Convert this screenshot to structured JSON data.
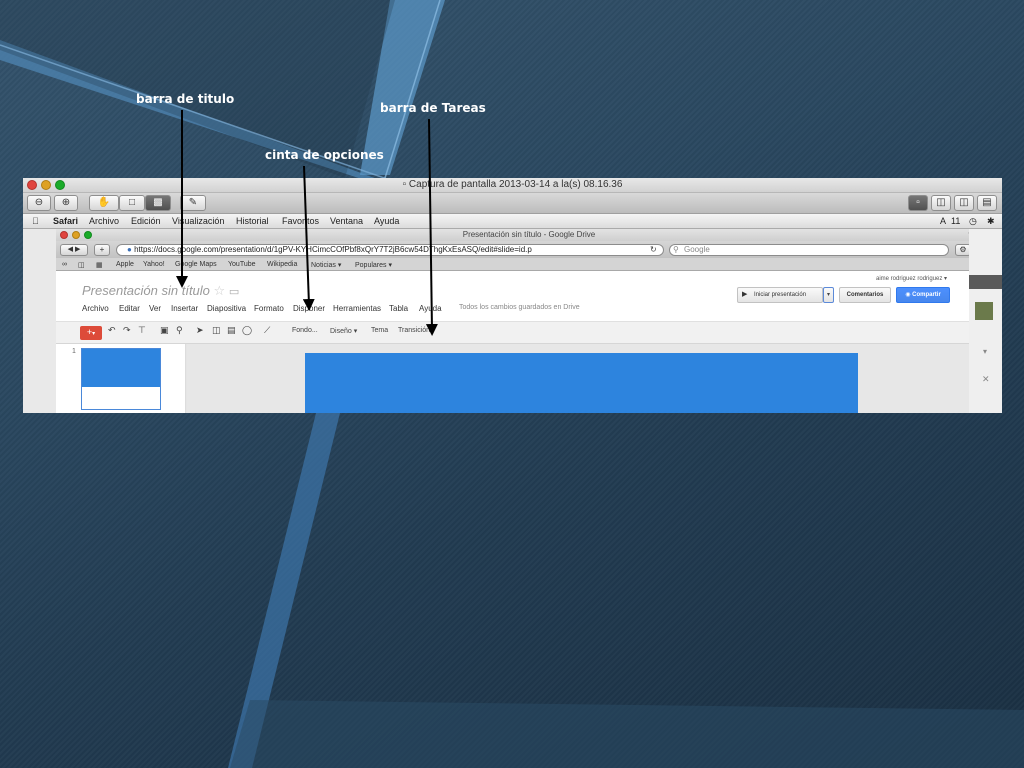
{
  "annotations": {
    "title_bar": "barra de titulo",
    "options_ribbon": "cinta de opciones",
    "task_bar": "barra de Tareas"
  },
  "preview": {
    "window_title": "Captura de pantalla 2013-03-14 a la(s) 08.16.36"
  },
  "mac_menu": {
    "apple": "",
    "items": [
      "Safari",
      "Archivo",
      "Edición",
      "Visualización",
      "Historial",
      "Favoritos",
      "Ventana",
      "Ayuda"
    ],
    "status": "11"
  },
  "safari": {
    "window_title": "Presentación sin título - Google Drive",
    "url": "https://docs.google.com/presentation/d/1gPV-KYHCimcCOfPbf8xQrY7T2jB6cw54DThgKxEsASQ/edit#slide=id.p",
    "search_placeholder": "Google",
    "bookmarks": [
      "Apple",
      "Yahoo!",
      "Google Maps",
      "YouTube",
      "Wikipedia",
      "Noticias ▾",
      "Populares ▾"
    ]
  },
  "docs": {
    "title": "Presentación sin título",
    "user": "aime rodriguez rodriguez ▾",
    "menu": [
      "Archivo",
      "Editar",
      "Ver",
      "Insertar",
      "Diapositiva",
      "Formato",
      "Disponer",
      "Herramientas",
      "Tabla",
      "Ayuda"
    ],
    "saved_message": "Todos los cambios guardados en Drive",
    "present_label": "Iniciar presentación",
    "comments_label": "Comentarios",
    "share_label": "Compartir",
    "toolbar": {
      "new": "+",
      "background": "Fondo...",
      "layout": "Diseño ▾",
      "theme": "Tema",
      "transition": "Transición"
    },
    "slide_number": "1"
  },
  "colors": {
    "slide_blue": "#2d84de",
    "share_blue": "#4d90fe",
    "new_red": "#dd4b39"
  }
}
